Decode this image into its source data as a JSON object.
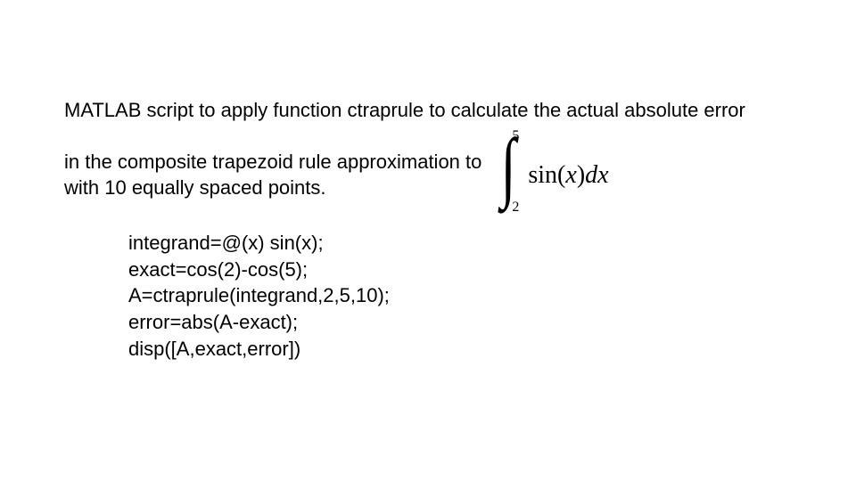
{
  "slide": {
    "line1": "MATLAB script to apply function ctraprule to calculate the actual absolute error",
    "line2a": "in the composite trapezoid rule approximation to",
    "line2b": "with 10 equally spaced points.",
    "integral": {
      "upper": "5",
      "lower": "2",
      "body_prefix": "sin(",
      "body_var": "x",
      "body_mid": ")",
      "body_dx_d": "d",
      "body_dx_x": "x"
    },
    "code": {
      "l1": "integrand=@(x) sin(x);",
      "l2": "exact=cos(2)-cos(5);",
      "l3": "A=ctraprule(integrand,2,5,10);",
      "l4": "error=abs(A-exact);",
      "l5": "disp([A,exact,error])"
    }
  }
}
